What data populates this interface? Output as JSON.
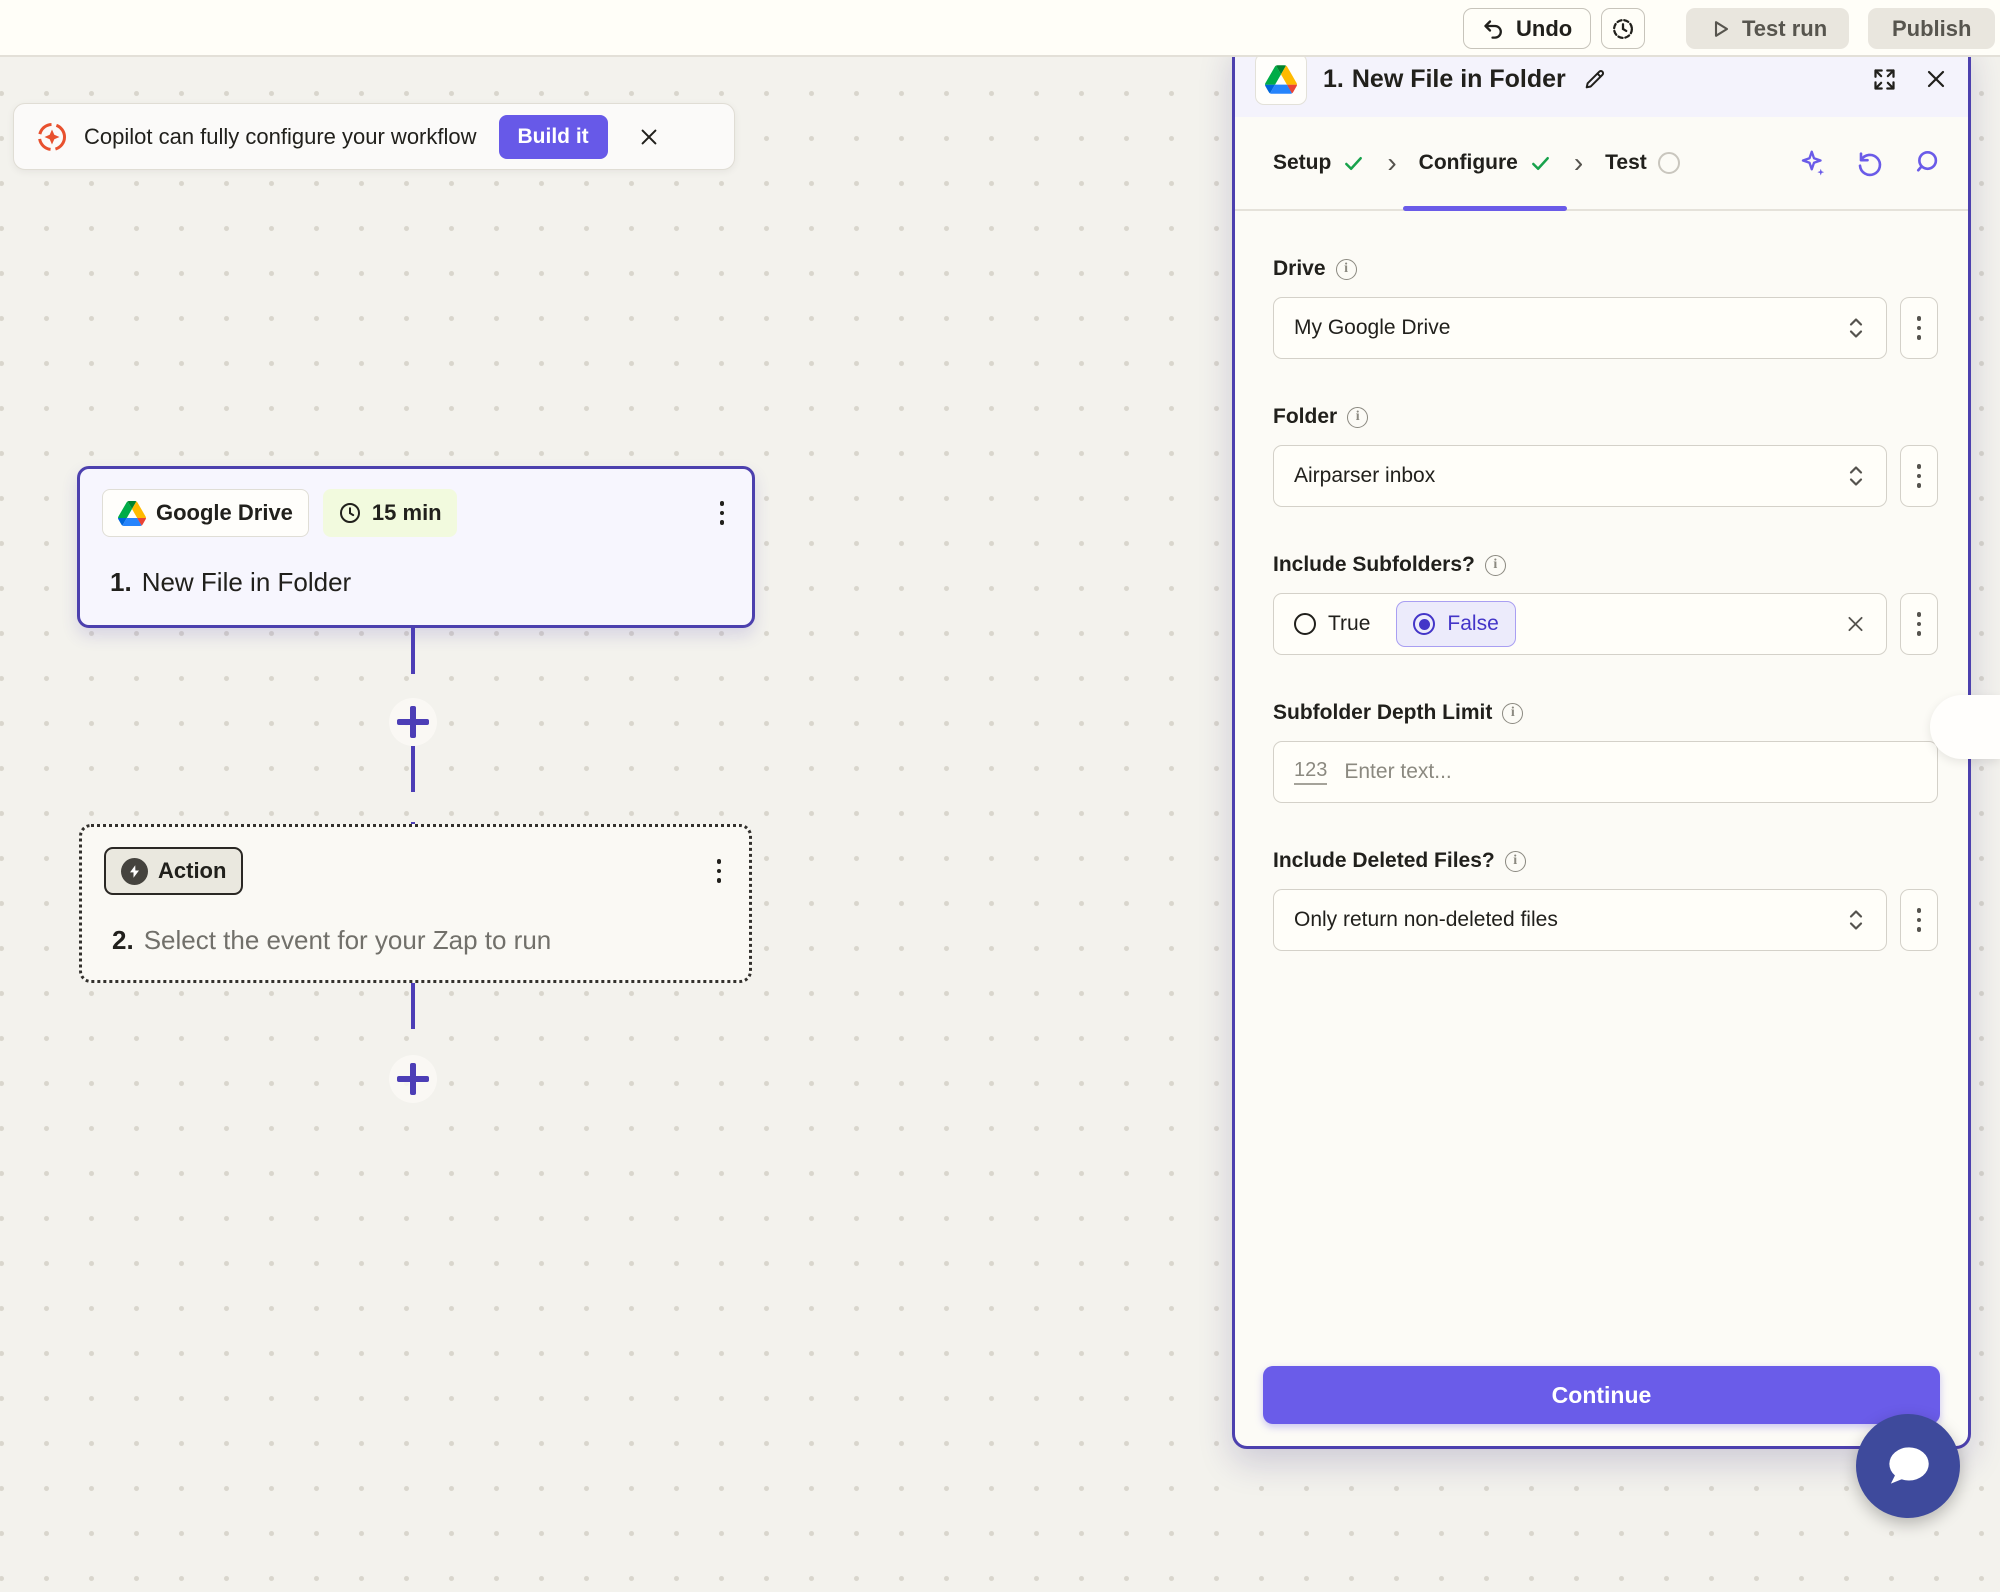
{
  "topbar": {
    "undo": "Undo",
    "test_run": "Test run",
    "publish": "Publish"
  },
  "banner": {
    "message": "Copilot can fully configure your workflow",
    "build_it": "Build it"
  },
  "canvas": {
    "trigger_card": {
      "app": "Google Drive",
      "interval": "15 min",
      "step": "1.",
      "title": "New File in Folder"
    },
    "action_card": {
      "badge": "Action",
      "step": "2.",
      "title": "Select the event for your Zap to run"
    }
  },
  "panel": {
    "step": "1.",
    "title": "New File in Folder",
    "tabs": [
      {
        "label": "Setup",
        "status": "complete"
      },
      {
        "label": "Configure",
        "status": "complete",
        "active": true
      },
      {
        "label": "Test",
        "status": "pending"
      }
    ],
    "fields": {
      "drive": {
        "label": "Drive",
        "value": "My Google Drive"
      },
      "folder": {
        "label": "Folder",
        "value": "Airparser inbox"
      },
      "subfolders": {
        "label": "Include Subfolders?",
        "options": [
          "True",
          "False"
        ],
        "selected": "False"
      },
      "depth": {
        "label": "Subfolder Depth Limit",
        "prefix": "123",
        "placeholder": "Enter text..."
      },
      "deleted": {
        "label": "Include Deleted Files?",
        "value": "Only return non-deleted files"
      }
    },
    "continue_label": "Continue"
  },
  "icons": {
    "info": "i",
    "tab_chevron": "›",
    "names": [
      "undo-icon",
      "history-icon",
      "play-icon",
      "copilot-icon",
      "close-icon",
      "google-drive-logo",
      "clock-icon",
      "kebab-icon",
      "bolt-icon",
      "plus-icon",
      "expand-icon",
      "pencil-icon",
      "check-icon",
      "sparkle-icon",
      "refresh-icon",
      "search-icon",
      "select-chevrons-icon",
      "radio-icon",
      "clear-x-icon",
      "chat-icon"
    ]
  },
  "colors": {
    "accent_purple": "#6A5CE9",
    "panel_border": "#4C40AE",
    "connector": "#4C3EB6",
    "success_green": "#18A24C",
    "copilot_orange": "#E8502E",
    "chat_indigo": "#3E4A9C",
    "canvas_bg": "#F3F2ED",
    "lime_badge": "#F2FADE",
    "quiet_button": "#E9E6DE"
  }
}
